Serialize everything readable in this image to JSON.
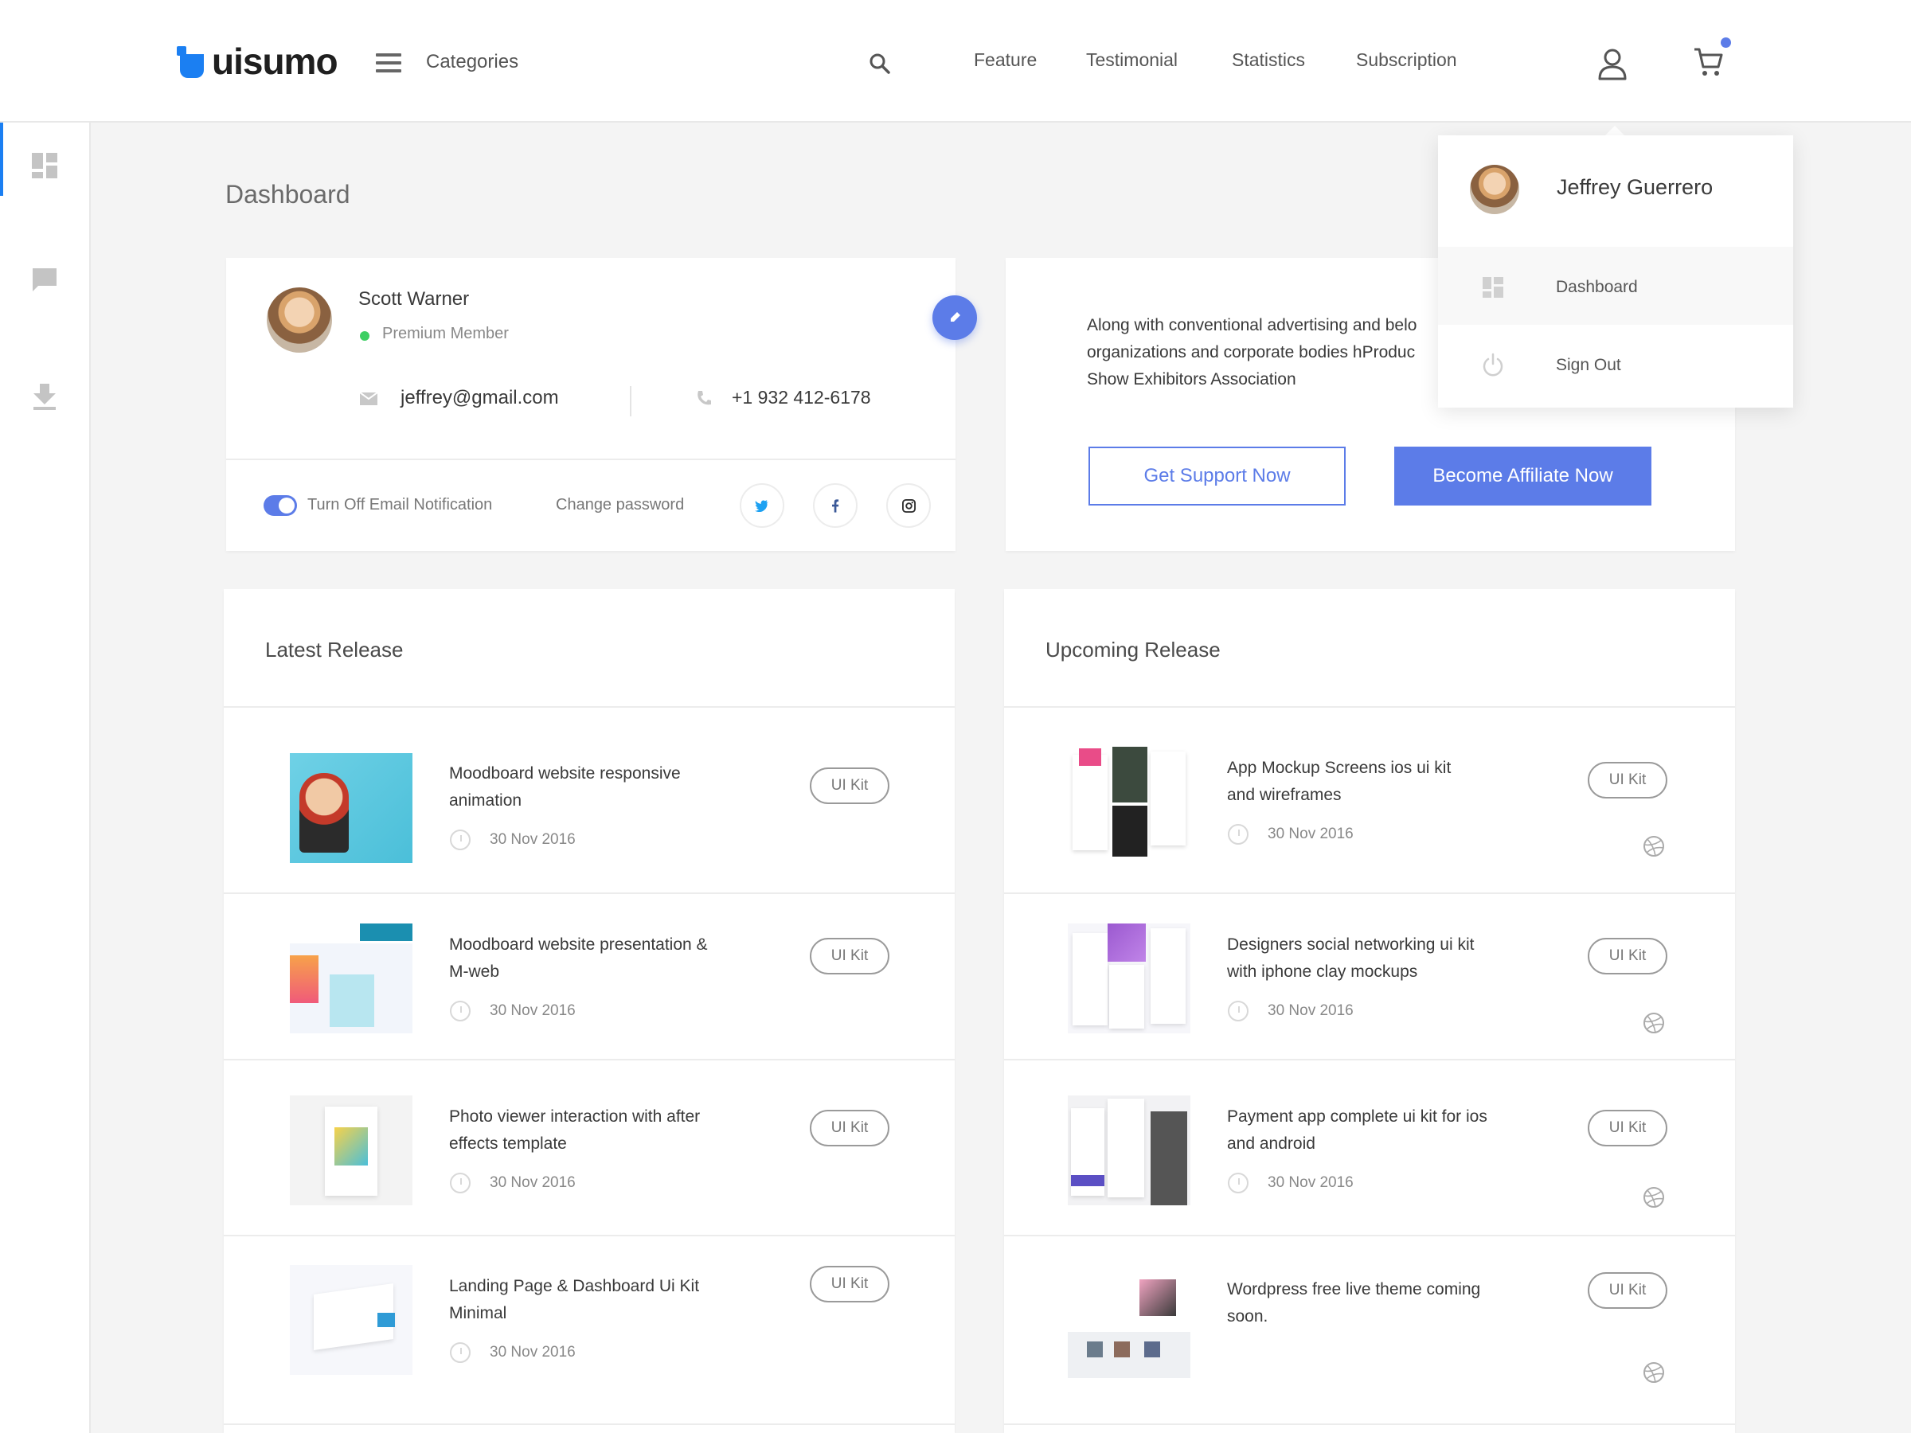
{
  "header": {
    "brand": "uisumo",
    "categories_label": "Categories",
    "nav": [
      "Feature",
      "Testimonial",
      "Statistics",
      "Subscription"
    ]
  },
  "page_title": "Dashboard",
  "profile": {
    "name": "Scott Warner",
    "status": "Premium Member",
    "email": "jeffrey@gmail.com",
    "phone": "+1 932 412-6178",
    "toggle_label": "Turn Off Email Notification",
    "change_password": "Change password"
  },
  "promo": {
    "text_lines": [
      "Along with conventional advertising and belo",
      "organizations and corporate bodies hProduc",
      "Show Exhibitors Association"
    ],
    "support_button": "Get Support Now",
    "affiliate_button": "Become Affiliate Now"
  },
  "dropdown": {
    "user_name": "Jeffrey Guerrero",
    "items": [
      "Dashboard",
      "Sign Out"
    ]
  },
  "latest": {
    "title": "Latest Release",
    "items": [
      {
        "title_lines": [
          "Moodboard website responsive",
          "animation"
        ],
        "date": "30 Nov 2016",
        "tag": "UI Kit"
      },
      {
        "title_lines": [
          "Moodboard website presentation &",
          "M-web"
        ],
        "date": "30 Nov 2016",
        "tag": "UI Kit"
      },
      {
        "title_lines": [
          "Photo viewer interaction with after",
          "effects template"
        ],
        "date": "30 Nov 2016",
        "tag": "UI Kit"
      },
      {
        "title_lines": [
          "Landing Page & Dashboard Ui Kit",
          "Minimal"
        ],
        "date": "30 Nov 2016",
        "tag": "UI Kit"
      }
    ]
  },
  "upcoming": {
    "title": "Upcoming Release",
    "items": [
      {
        "title_lines": [
          "App Mockup Screens ios ui kit",
          "and wireframes"
        ],
        "date": "30 Nov 2016",
        "tag": "UI Kit"
      },
      {
        "title_lines": [
          "Designers social networking ui kit",
          "with iphone clay mockups"
        ],
        "date": "30 Nov 2016",
        "tag": "UI Kit"
      },
      {
        "title_lines": [
          "Payment app complete ui kit for ios",
          "and android"
        ],
        "date": "30 Nov 2016",
        "tag": "UI Kit"
      },
      {
        "title_lines": [
          "Wordpress free live theme coming",
          "soon."
        ],
        "date": "",
        "tag": "UI Kit"
      }
    ]
  },
  "colors": {
    "accent": "#5c7ce8",
    "brand": "#1b7ff2",
    "online": "#3dcf63"
  },
  "icons": [
    "menu-icon",
    "search-icon",
    "user-icon",
    "cart-icon",
    "dashboard-icon",
    "chat-icon",
    "download-icon",
    "mail-icon",
    "phone-icon",
    "pencil-icon",
    "twitter-icon",
    "facebook-icon",
    "instagram-icon",
    "power-icon",
    "clock-icon",
    "dribbble-icon"
  ]
}
